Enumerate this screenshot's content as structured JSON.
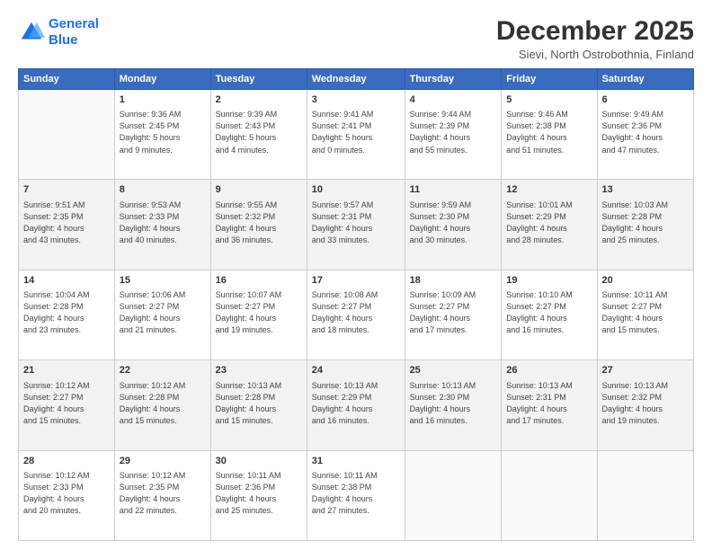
{
  "logo": {
    "line1": "General",
    "line2": "Blue"
  },
  "title": "December 2025",
  "subtitle": "Sievi, North Ostrobothnia, Finland",
  "days_of_week": [
    "Sunday",
    "Monday",
    "Tuesday",
    "Wednesday",
    "Thursday",
    "Friday",
    "Saturday"
  ],
  "weeks": [
    [
      {
        "day": "",
        "info": ""
      },
      {
        "day": "1",
        "info": "Sunrise: 9:36 AM\nSunset: 2:45 PM\nDaylight: 5 hours\nand 9 minutes."
      },
      {
        "day": "2",
        "info": "Sunrise: 9:39 AM\nSunset: 2:43 PM\nDaylight: 5 hours\nand 4 minutes."
      },
      {
        "day": "3",
        "info": "Sunrise: 9:41 AM\nSunset: 2:41 PM\nDaylight: 5 hours\nand 0 minutes."
      },
      {
        "day": "4",
        "info": "Sunrise: 9:44 AM\nSunset: 2:39 PM\nDaylight: 4 hours\nand 55 minutes."
      },
      {
        "day": "5",
        "info": "Sunrise: 9:46 AM\nSunset: 2:38 PM\nDaylight: 4 hours\nand 51 minutes."
      },
      {
        "day": "6",
        "info": "Sunrise: 9:49 AM\nSunset: 2:36 PM\nDaylight: 4 hours\nand 47 minutes."
      }
    ],
    [
      {
        "day": "7",
        "info": "Sunrise: 9:51 AM\nSunset: 2:35 PM\nDaylight: 4 hours\nand 43 minutes."
      },
      {
        "day": "8",
        "info": "Sunrise: 9:53 AM\nSunset: 2:33 PM\nDaylight: 4 hours\nand 40 minutes."
      },
      {
        "day": "9",
        "info": "Sunrise: 9:55 AM\nSunset: 2:32 PM\nDaylight: 4 hours\nand 36 minutes."
      },
      {
        "day": "10",
        "info": "Sunrise: 9:57 AM\nSunset: 2:31 PM\nDaylight: 4 hours\nand 33 minutes."
      },
      {
        "day": "11",
        "info": "Sunrise: 9:59 AM\nSunset: 2:30 PM\nDaylight: 4 hours\nand 30 minutes."
      },
      {
        "day": "12",
        "info": "Sunrise: 10:01 AM\nSunset: 2:29 PM\nDaylight: 4 hours\nand 28 minutes."
      },
      {
        "day": "13",
        "info": "Sunrise: 10:03 AM\nSunset: 2:28 PM\nDaylight: 4 hours\nand 25 minutes."
      }
    ],
    [
      {
        "day": "14",
        "info": "Sunrise: 10:04 AM\nSunset: 2:28 PM\nDaylight: 4 hours\nand 23 minutes."
      },
      {
        "day": "15",
        "info": "Sunrise: 10:06 AM\nSunset: 2:27 PM\nDaylight: 4 hours\nand 21 minutes."
      },
      {
        "day": "16",
        "info": "Sunrise: 10:07 AM\nSunset: 2:27 PM\nDaylight: 4 hours\nand 19 minutes."
      },
      {
        "day": "17",
        "info": "Sunrise: 10:08 AM\nSunset: 2:27 PM\nDaylight: 4 hours\nand 18 minutes."
      },
      {
        "day": "18",
        "info": "Sunrise: 10:09 AM\nSunset: 2:27 PM\nDaylight: 4 hours\nand 17 minutes."
      },
      {
        "day": "19",
        "info": "Sunrise: 10:10 AM\nSunset: 2:27 PM\nDaylight: 4 hours\nand 16 minutes."
      },
      {
        "day": "20",
        "info": "Sunrise: 10:11 AM\nSunset: 2:27 PM\nDaylight: 4 hours\nand 15 minutes."
      }
    ],
    [
      {
        "day": "21",
        "info": "Sunrise: 10:12 AM\nSunset: 2:27 PM\nDaylight: 4 hours\nand 15 minutes."
      },
      {
        "day": "22",
        "info": "Sunrise: 10:12 AM\nSunset: 2:28 PM\nDaylight: 4 hours\nand 15 minutes."
      },
      {
        "day": "23",
        "info": "Sunrise: 10:13 AM\nSunset: 2:28 PM\nDaylight: 4 hours\nand 15 minutes."
      },
      {
        "day": "24",
        "info": "Sunrise: 10:13 AM\nSunset: 2:29 PM\nDaylight: 4 hours\nand 16 minutes."
      },
      {
        "day": "25",
        "info": "Sunrise: 10:13 AM\nSunset: 2:30 PM\nDaylight: 4 hours\nand 16 minutes."
      },
      {
        "day": "26",
        "info": "Sunrise: 10:13 AM\nSunset: 2:31 PM\nDaylight: 4 hours\nand 17 minutes."
      },
      {
        "day": "27",
        "info": "Sunrise: 10:13 AM\nSunset: 2:32 PM\nDaylight: 4 hours\nand 19 minutes."
      }
    ],
    [
      {
        "day": "28",
        "info": "Sunrise: 10:12 AM\nSunset: 2:33 PM\nDaylight: 4 hours\nand 20 minutes."
      },
      {
        "day": "29",
        "info": "Sunrise: 10:12 AM\nSunset: 2:35 PM\nDaylight: 4 hours\nand 22 minutes."
      },
      {
        "day": "30",
        "info": "Sunrise: 10:11 AM\nSunset: 2:36 PM\nDaylight: 4 hours\nand 25 minutes."
      },
      {
        "day": "31",
        "info": "Sunrise: 10:11 AM\nSunset: 2:38 PM\nDaylight: 4 hours\nand 27 minutes."
      },
      {
        "day": "",
        "info": ""
      },
      {
        "day": "",
        "info": ""
      },
      {
        "day": "",
        "info": ""
      }
    ]
  ]
}
